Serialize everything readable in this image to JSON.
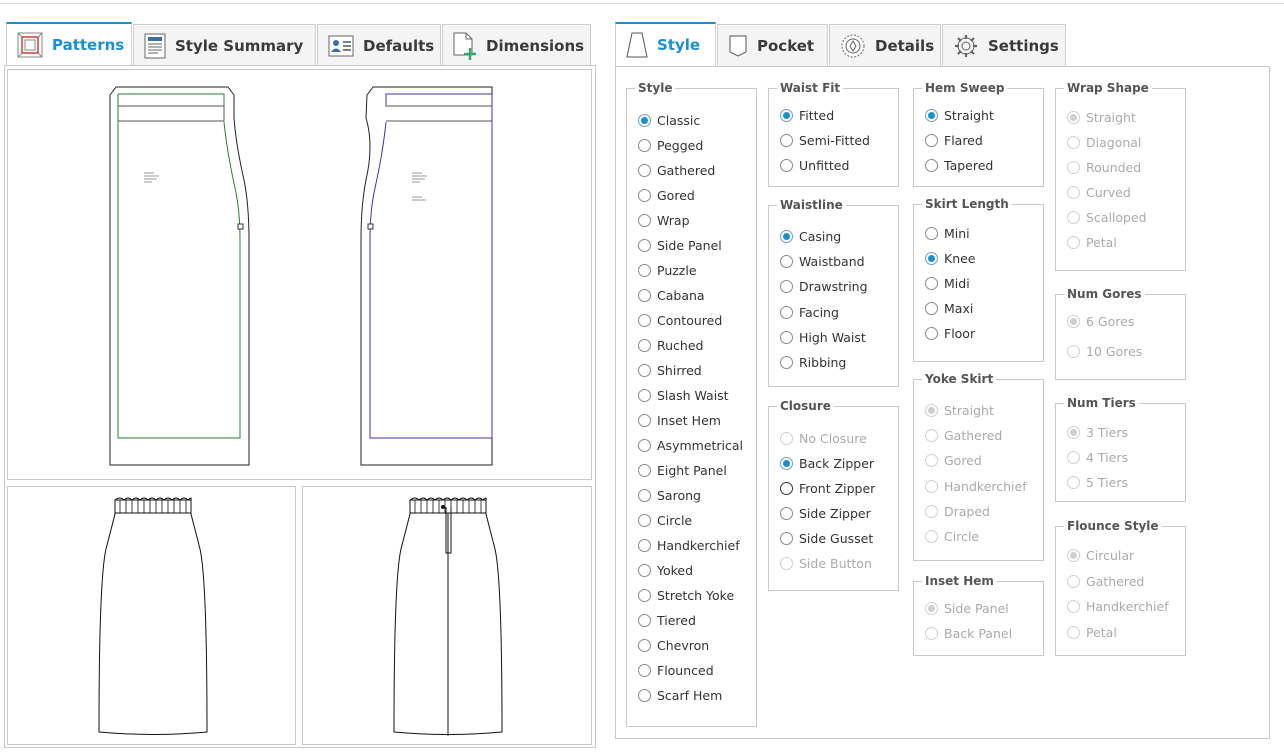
{
  "left_tabs": [
    {
      "key": "patterns",
      "label": "Patterns",
      "icon": "patterns-icon"
    },
    {
      "key": "summary",
      "label": "Style Summary",
      "icon": "document-icon"
    },
    {
      "key": "defaults",
      "label": "Defaults",
      "icon": "user-card-icon"
    },
    {
      "key": "dimensions",
      "label": "Dimensions",
      "icon": "new-page-icon"
    }
  ],
  "right_tabs": [
    {
      "key": "style",
      "label": "Style",
      "icon": "skirt-icon"
    },
    {
      "key": "pocket",
      "label": "Pocket",
      "icon": "pocket-icon"
    },
    {
      "key": "details",
      "label": "Details",
      "icon": "badge-icon"
    },
    {
      "key": "settings",
      "label": "Settings",
      "icon": "gear-icon"
    }
  ],
  "groups": {
    "style": {
      "legend": "Style",
      "options": [
        "Classic",
        "Pegged",
        "Gathered",
        "Gored",
        "Wrap",
        "Side Panel",
        "Puzzle",
        "Cabana",
        "Contoured",
        "Ruched",
        "Shirred",
        "Slash Waist",
        "Inset Hem",
        "Asymmetrical",
        "Eight Panel",
        "Sarong",
        "Circle",
        "Handkerchief",
        "Yoked",
        "Stretch Yoke",
        "Tiered",
        "Chevron",
        "Flounced",
        "Scarf Hem"
      ],
      "selected": "Classic"
    },
    "waist_fit": {
      "legend": "Waist Fit",
      "options": [
        "Fitted",
        "Semi-Fitted",
        "Unfitted"
      ],
      "selected": "Fitted"
    },
    "waistline": {
      "legend": "Waistline",
      "options": [
        "Casing",
        "Waistband",
        "Drawstring",
        "Facing",
        "High Waist",
        "Ribbing"
      ],
      "selected": "Casing"
    },
    "closure": {
      "legend": "Closure",
      "options": [
        "No Closure",
        "Back Zipper",
        "Front Zipper",
        "Side Zipper",
        "Side Gusset",
        "Side Button"
      ],
      "selected": "Back Zipper",
      "disabled": [
        "No Closure",
        "Side Button"
      ]
    },
    "hem_sweep": {
      "legend": "Hem Sweep",
      "options": [
        "Straight",
        "Flared",
        "Tapered"
      ],
      "selected": "Straight"
    },
    "skirt_length": {
      "legend": "Skirt Length",
      "options": [
        "Mini",
        "Knee",
        "Midi",
        "Maxi",
        "Floor"
      ],
      "selected": "Knee"
    },
    "yoke_skirt": {
      "legend": "Yoke Skirt",
      "options": [
        "Straight",
        "Gathered",
        "Gored",
        "Handkerchief",
        "Draped",
        "Circle"
      ],
      "selected": "Straight",
      "all_disabled": true
    },
    "inset_hem": {
      "legend": "Inset Hem",
      "options": [
        "Side Panel",
        "Back Panel"
      ],
      "selected": "Side Panel",
      "all_disabled": true
    },
    "wrap_shape": {
      "legend": "Wrap Shape",
      "options": [
        "Straight",
        "Diagonal",
        "Rounded",
        "Curved",
        "Scalloped",
        "Petal"
      ],
      "selected": "Straight",
      "all_disabled": true
    },
    "num_gores": {
      "legend": "Num Gores",
      "options": [
        "6 Gores",
        "10 Gores"
      ],
      "selected": "6 Gores",
      "all_disabled": true
    },
    "num_tiers": {
      "legend": "Num Tiers",
      "options": [
        "3 Tiers",
        "4 Tiers",
        "5 Tiers"
      ],
      "selected": "3 Tiers",
      "all_disabled": true
    },
    "flounce_style": {
      "legend": "Flounce Style",
      "options": [
        "Circular",
        "Gathered",
        "Handkerchief",
        "Petal"
      ],
      "selected": "Circular",
      "all_disabled": true
    }
  },
  "colors": {
    "accent": "#1a8fd1",
    "seam_front": "#2e7d32",
    "seam_back": "#4b2e9e"
  }
}
